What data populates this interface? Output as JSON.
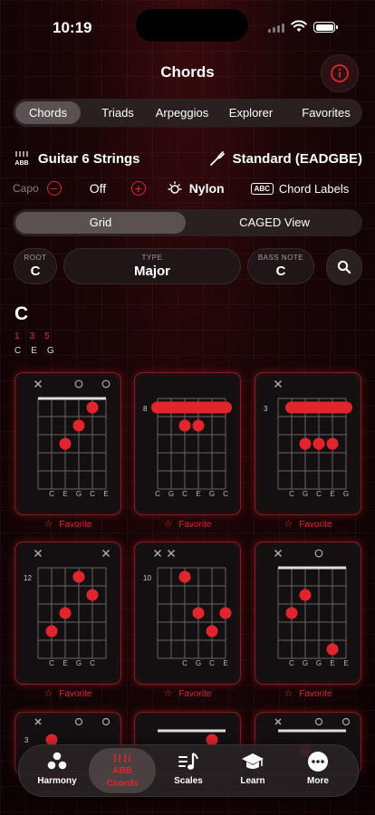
{
  "status": {
    "time": "10:19"
  },
  "header": {
    "title": "Chords"
  },
  "tabs": [
    "Chords",
    "Triads",
    "Arpeggios",
    "Explorer",
    "Favorites"
  ],
  "instrument": {
    "name": "Guitar 6 Strings",
    "tuning": "Standard (EADGBE)"
  },
  "capo": {
    "label": "Capo",
    "value": "Off"
  },
  "options": {
    "string_type": "Nylon",
    "abc_badge": "ABC",
    "labels": "Chord Labels"
  },
  "view_toggle": [
    "Grid",
    "CAGED View"
  ],
  "selectors": {
    "root": {
      "label": "ROOT",
      "value": "C"
    },
    "type": {
      "label": "TYPE",
      "value": "Major"
    },
    "bass": {
      "label": "BASS NOTE",
      "value": "C"
    }
  },
  "chord": {
    "name": "C",
    "degrees": [
      "1",
      "3",
      "5"
    ],
    "notes": [
      "C",
      "E",
      "G"
    ]
  },
  "favorite_label": "Favorite",
  "colors": {
    "accent": "#e0252d",
    "background": "#1b0507"
  },
  "voicings": [
    {
      "fret": "",
      "nut": true,
      "muted": [
        0
      ],
      "open": [
        3,
        5
      ],
      "dots": [
        [
          1,
          4
        ],
        [
          2,
          3
        ],
        [
          3,
          2
        ]
      ],
      "barre": null,
      "labels": [
        "",
        "C",
        "E",
        "G",
        "C",
        "E"
      ]
    },
    {
      "fret": "8",
      "nut": false,
      "muted": [],
      "open": [],
      "dots": [
        [
          2,
          2
        ],
        [
          2,
          3
        ]
      ],
      "barre": [
        1,
        0,
        5
      ],
      "labels": [
        "C",
        "G",
        "C",
        "E",
        "G",
        "C"
      ]
    },
    {
      "fret": "3",
      "nut": false,
      "muted": [
        0
      ],
      "open": [],
      "dots": [
        [
          3,
          2
        ],
        [
          3,
          3
        ],
        [
          3,
          4
        ]
      ],
      "barre": [
        1,
        1,
        5
      ],
      "labels": [
        "",
        "C",
        "G",
        "C",
        "E",
        "G"
      ]
    },
    {
      "fret": "12",
      "nut": false,
      "muted": [
        0,
        5
      ],
      "open": [],
      "dots": [
        [
          1,
          3
        ],
        [
          2,
          4
        ],
        [
          3,
          2
        ],
        [
          4,
          1
        ]
      ],
      "barre": null,
      "labels": [
        "",
        "C",
        "E",
        "G",
        "C",
        ""
      ]
    },
    {
      "fret": "10",
      "nut": false,
      "muted": [
        0,
        1
      ],
      "open": [],
      "dots": [
        [
          1,
          2
        ],
        [
          3,
          3
        ],
        [
          3,
          5
        ],
        [
          4,
          4
        ]
      ],
      "barre": null,
      "labels": [
        "",
        "",
        "C",
        "G",
        "C",
        "E"
      ]
    },
    {
      "fret": "",
      "nut": true,
      "muted": [
        0
      ],
      "open": [
        3
      ],
      "dots": [
        [
          2,
          2
        ],
        [
          3,
          1
        ],
        [
          5,
          4
        ]
      ],
      "barre": null,
      "labels": [
        "",
        "C",
        "G",
        "G",
        "E",
        "E"
      ]
    }
  ],
  "tabbar": [
    "Harmony",
    "Chords",
    "Scales",
    "Learn",
    "More"
  ]
}
